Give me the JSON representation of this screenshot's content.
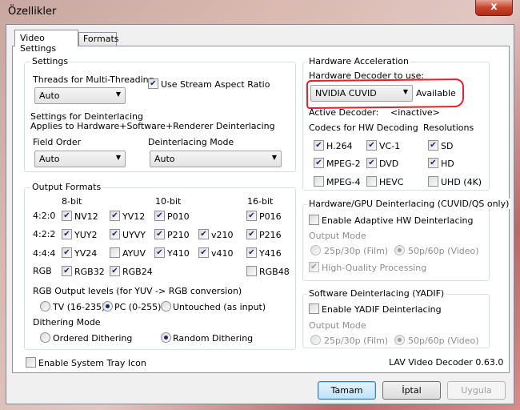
{
  "window": {
    "title": "Özellikler",
    "close_glyph": "x"
  },
  "tabs": [
    "Video Settings",
    "Formats"
  ],
  "settings": {
    "group_title": "Settings",
    "threads_label": "Threads for Multi-Threading",
    "threads_value": "Auto",
    "stream_aspect_label": "Use Stream Aspect Ratio",
    "stream_aspect_checked": true,
    "deint_title": "Settings for Deinterlacing",
    "deint_sub": "Applies to Hardware+Software+Renderer Deinterlacing",
    "field_order_label": "Field Order",
    "field_order_value": "Auto",
    "deint_mode_label": "Deinterlacing Mode",
    "deint_mode_value": "Auto"
  },
  "output_formats": {
    "group_title": "Output Formats",
    "headers": [
      "8-bit",
      "10-bit",
      "16-bit"
    ],
    "rows": [
      {
        "label": "4:2:0",
        "items": [
          {
            "name": "NV12",
            "checked": true
          },
          {
            "name": "YV12",
            "checked": true
          },
          {
            "name": "P010",
            "checked": true
          },
          {
            "name": "P016",
            "checked": true
          }
        ]
      },
      {
        "label": "4:2:2",
        "items": [
          {
            "name": "YUY2",
            "checked": true
          },
          {
            "name": "UYVY",
            "checked": true
          },
          {
            "name": "P210",
            "checked": true
          },
          {
            "name": "v210",
            "checked": true
          },
          {
            "name": "P216",
            "checked": true
          }
        ]
      },
      {
        "label": "4:4:4",
        "items": [
          {
            "name": "YV24",
            "checked": true
          },
          {
            "name": "AYUV",
            "checked": false
          },
          {
            "name": "Y410",
            "checked": true
          },
          {
            "name": "v410",
            "checked": true
          },
          {
            "name": "Y416",
            "checked": true
          }
        ]
      },
      {
        "label": "RGB",
        "items": [
          {
            "name": "RGB32",
            "checked": true
          },
          {
            "name": "RGB24",
            "checked": true
          },
          {
            "name": "RGB48",
            "checked": false
          }
        ]
      }
    ],
    "rgb_levels_label": "RGB Output levels (for YUV -> RGB conversion)",
    "rgb_levels_options": [
      {
        "label": "TV (16-235)",
        "selected": false
      },
      {
        "label": "PC (0-255)",
        "selected": true
      },
      {
        "label": "Untouched (as input)",
        "selected": false
      }
    ],
    "dither_label": "Dithering Mode",
    "dither_options": [
      {
        "label": "Ordered Dithering",
        "selected": false
      },
      {
        "label": "Random Dithering",
        "selected": true
      }
    ]
  },
  "system_tray_label": "Enable System Tray Icon",
  "system_tray_checked": false,
  "hw_accel": {
    "group_title": "Hardware Acceleration",
    "decoder_label": "Hardware Decoder to use:",
    "decoder_value": "NVIDIA CUVID",
    "decoder_status": "Available",
    "active_label": "Active Decoder:",
    "active_value": "<inactive>",
    "codecs_label": "Codecs for HW Decoding",
    "resolutions_label": "Resolutions",
    "codecs": [
      {
        "name": "H.264",
        "checked": true
      },
      {
        "name": "VC-1",
        "checked": true
      },
      {
        "name": "MPEG-2",
        "checked": true
      },
      {
        "name": "DVD",
        "checked": true
      },
      {
        "name": "MPEG-4",
        "checked": false
      },
      {
        "name": "HEVC",
        "checked": false
      }
    ],
    "resolutions": [
      {
        "name": "SD",
        "checked": true
      },
      {
        "name": "HD",
        "checked": true
      },
      {
        "name": "UHD (4K)",
        "checked": false
      }
    ]
  },
  "hw_deint": {
    "group_title": "Hardware/GPU Deinterlacing (CUVID/QS only)",
    "enable_label": "Enable Adaptive HW Deinterlacing",
    "enable_checked": false,
    "output_mode_label": "Output Mode",
    "mode_options": [
      {
        "label": "25p/30p (Film)",
        "selected": false
      },
      {
        "label": "50p/60p (Video)",
        "selected": true
      }
    ],
    "hq_label": "High-Quality Processing",
    "hq_checked": true
  },
  "sw_deint": {
    "group_title": "Software Deinterlacing (YADIF)",
    "enable_label": "Enable YADIF Deinterlacing",
    "enable_checked": false,
    "output_mode_label": "Output Mode",
    "mode_options": [
      {
        "label": "25p/30p (Film)",
        "selected": false
      },
      {
        "label": "50p/60p (Video)",
        "selected": true
      }
    ]
  },
  "version": "LAV Video Decoder 0.63.0",
  "buttons": {
    "ok": "Tamam",
    "cancel": "İptal",
    "apply": "Uygula"
  },
  "icons": {
    "check": "✔",
    "arrow": "▼"
  }
}
